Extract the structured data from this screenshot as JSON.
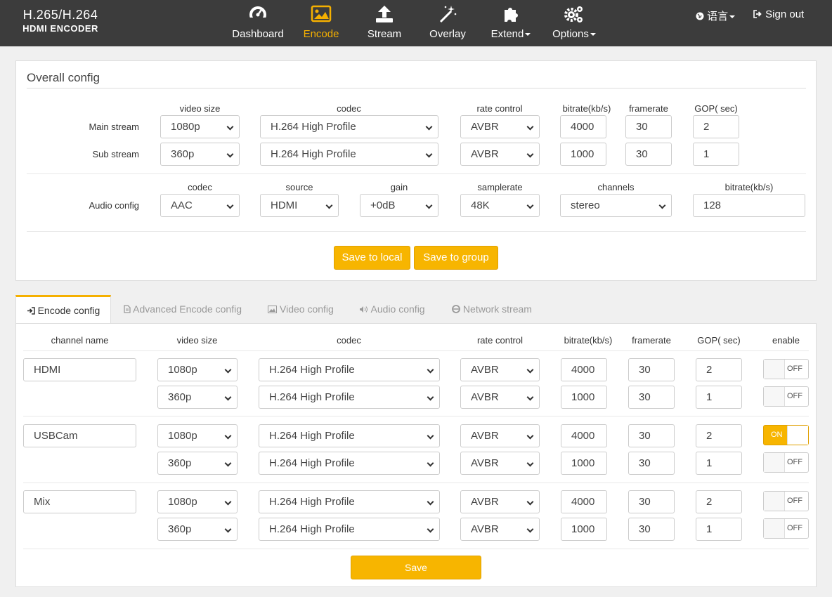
{
  "brand": {
    "line1": "H.265/H.264",
    "line2": "HDMI ENCODER"
  },
  "nav": {
    "dashboard": "Dashboard",
    "encode": "Encode",
    "stream": "Stream",
    "overlay": "Overlay",
    "extend": "Extend",
    "options": "Options",
    "language": "语言",
    "signout": "Sign out"
  },
  "overall": {
    "title": "Overall config",
    "headers": {
      "video_size": "video size",
      "codec": "codec",
      "rate_control": "rate control",
      "bitrate": "bitrate(kb/s)",
      "framerate": "framerate",
      "gop": "GOP( sec)"
    },
    "main": {
      "label": "Main stream",
      "video_size": "1080p",
      "codec": "H.264 High Profile",
      "rate_control": "AVBR",
      "bitrate": "4000",
      "framerate": "30",
      "gop": "2"
    },
    "sub": {
      "label": "Sub stream",
      "video_size": "360p",
      "codec": "H.264 High Profile",
      "rate_control": "AVBR",
      "bitrate": "1000",
      "framerate": "30",
      "gop": "1"
    },
    "audio": {
      "label": "Audio config",
      "headers": {
        "codec": "codec",
        "source": "source",
        "gain": "gain",
        "samplerate": "samplerate",
        "channels": "channels",
        "bitrate": "bitrate(kb/s)"
      },
      "codec": "AAC",
      "source": "HDMI",
      "gain": "+0dB",
      "samplerate": "48K",
      "channels": "stereo",
      "bitrate": "128"
    },
    "save_local": "Save to local",
    "save_group": "Save to group"
  },
  "tabs": {
    "encode": "Encode config",
    "advanced": "Advanced Encode config",
    "video": "Video config",
    "audio": "Audio config",
    "network": "Network stream"
  },
  "encode": {
    "headers": {
      "channel_name": "channel name",
      "video_size": "video size",
      "codec": "codec",
      "rate_control": "rate control",
      "bitrate": "bitrate(kb/s)",
      "framerate": "framerate",
      "gop": "GOP( sec)",
      "enable": "enable"
    },
    "channels": [
      {
        "name": "HDMI",
        "main": {
          "video_size": "1080p",
          "codec": "H.264 High Profile",
          "rate_control": "AVBR",
          "bitrate": "4000",
          "framerate": "30",
          "gop": "2",
          "enable": "OFF"
        },
        "sub": {
          "video_size": "360p",
          "codec": "H.264 High Profile",
          "rate_control": "AVBR",
          "bitrate": "1000",
          "framerate": "30",
          "gop": "1",
          "enable": "OFF"
        }
      },
      {
        "name": "USBCam",
        "main": {
          "video_size": "1080p",
          "codec": "H.264 High Profile",
          "rate_control": "AVBR",
          "bitrate": "4000",
          "framerate": "30",
          "gop": "2",
          "enable": "ON"
        },
        "sub": {
          "video_size": "360p",
          "codec": "H.264 High Profile",
          "rate_control": "AVBR",
          "bitrate": "1000",
          "framerate": "30",
          "gop": "1",
          "enable": "OFF"
        }
      },
      {
        "name": "Mix",
        "main": {
          "video_size": "1080p",
          "codec": "H.264 High Profile",
          "rate_control": "AVBR",
          "bitrate": "4000",
          "framerate": "30",
          "gop": "2",
          "enable": "OFF"
        },
        "sub": {
          "video_size": "360p",
          "codec": "H.264 High Profile",
          "rate_control": "AVBR",
          "bitrate": "1000",
          "framerate": "30",
          "gop": "1",
          "enable": "OFF"
        }
      }
    ],
    "save": "Save"
  },
  "colors": {
    "accent": "#f5b000",
    "topbar": "#3c3c3c"
  }
}
